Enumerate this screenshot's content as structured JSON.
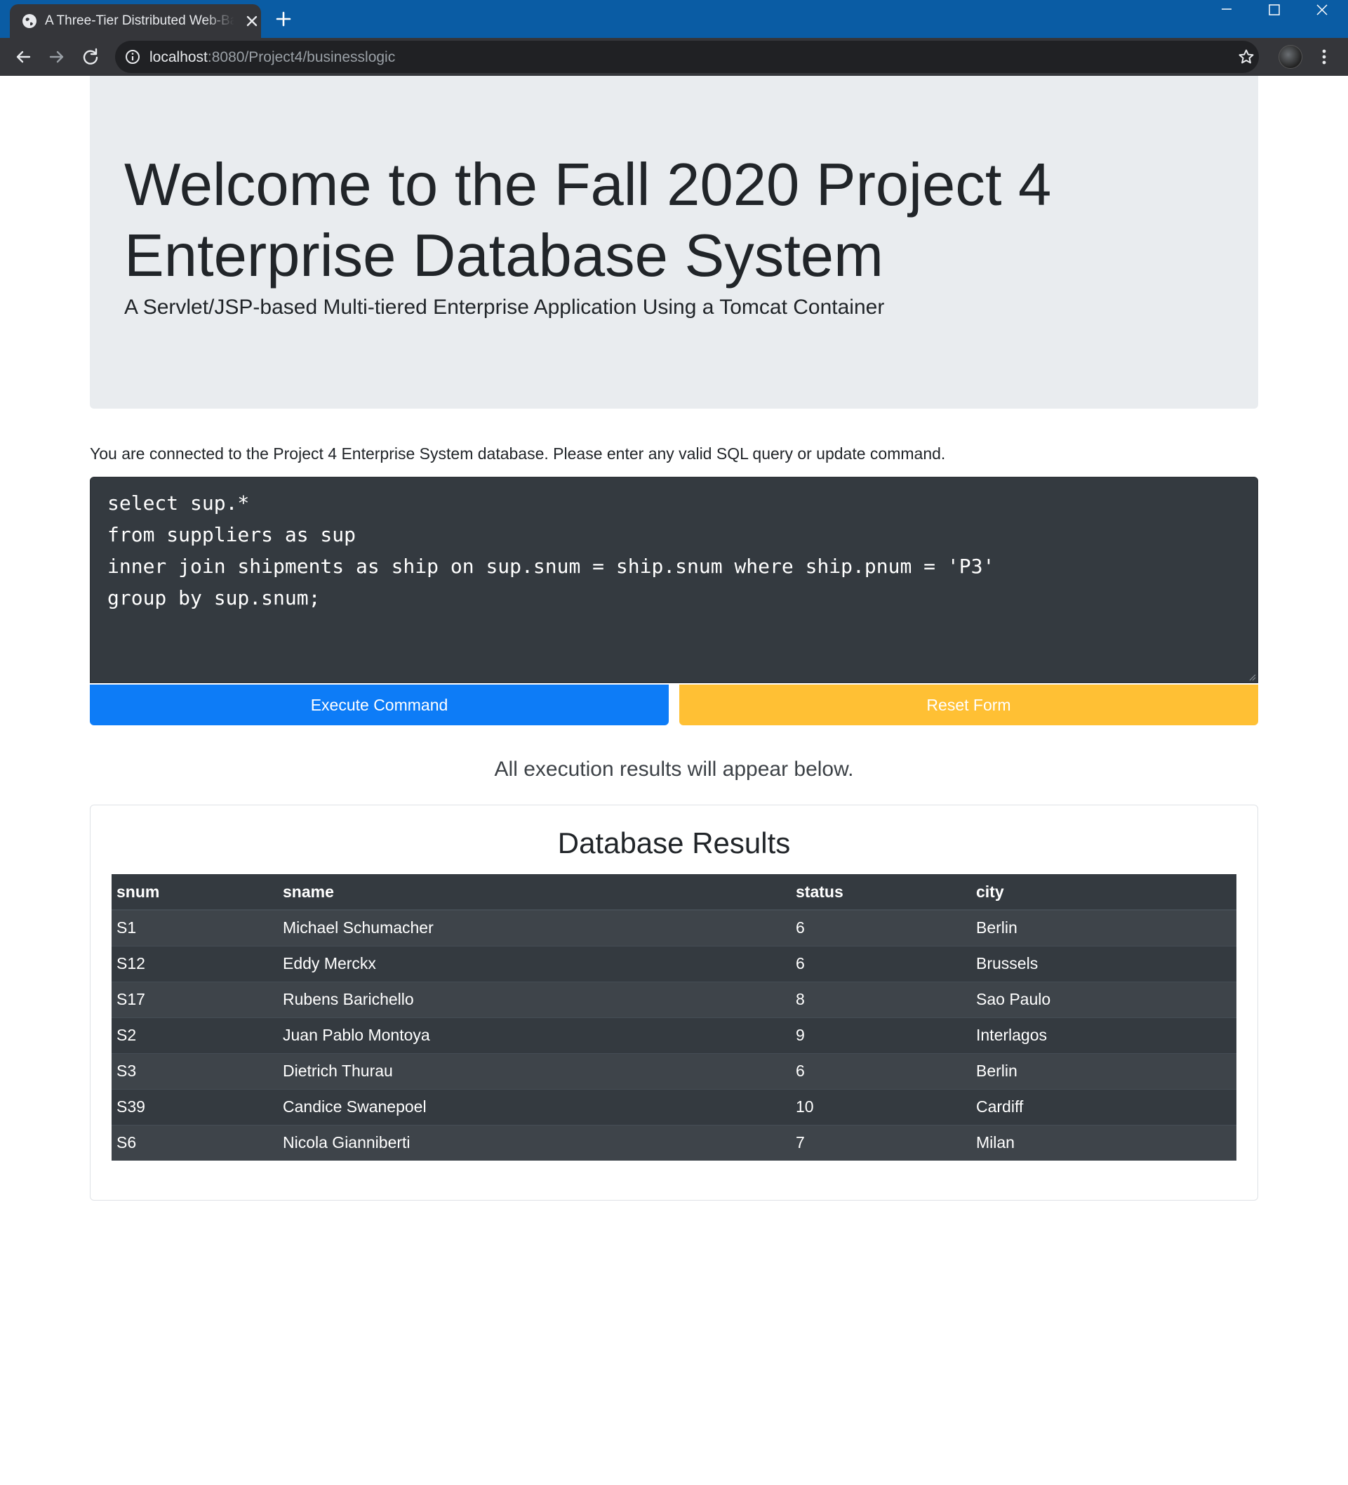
{
  "browser": {
    "tab_title": "A Three-Tier Distributed Web-Based Application",
    "url_host": "localhost",
    "url_rest": ":8080/Project4/businesslogic"
  },
  "jumbotron": {
    "title": "Welcome to the Fall 2020 Project 4 Enterprise Database System",
    "subtitle": "A Servlet/JSP-based Multi-tiered Enterprise Application Using a Tomcat Container"
  },
  "intro_text": "You are connected to the Project 4 Enterprise System database. Please enter any valid SQL query or update command.",
  "sql_query": {
    "lines": [
      "select sup.*",
      "from suppliers as sup",
      "inner join shipments as ship on sup.snum = ship.snum where ship.pnum = 'P3'",
      "group by sup.snum;"
    ]
  },
  "buttons": {
    "execute_label": "Execute Command",
    "reset_label": "Reset Form"
  },
  "results_note": "All execution results will appear below.",
  "results": {
    "title": "Database Results",
    "columns": [
      "snum",
      "sname",
      "status",
      "city"
    ],
    "rows": [
      [
        "S1",
        "Michael Schumacher",
        "6",
        "Berlin"
      ],
      [
        "S12",
        "Eddy Merckx",
        "6",
        "Brussels"
      ],
      [
        "S17",
        "Rubens Barichello",
        "8",
        "Sao Paulo"
      ],
      [
        "S2",
        "Juan Pablo Montoya",
        "9",
        "Interlagos"
      ],
      [
        "S3",
        "Dietrich Thurau",
        "6",
        "Berlin"
      ],
      [
        "S39",
        "Candice Swanepoel",
        "10",
        "Cardiff"
      ],
      [
        "S6",
        "Nicola Gianniberti",
        "7",
        "Milan"
      ]
    ]
  },
  "colors": {
    "titlebar": "#0a5ca4",
    "execute_button": "#0d7cf7",
    "reset_button": "#ffc034",
    "dark_panel": "#343a40",
    "jumbotron": "#e9ecef"
  },
  "icons": [
    "globe-icon",
    "close-icon",
    "plus-icon",
    "minimize-icon",
    "maximize-icon",
    "window-close-icon",
    "back-arrow-icon",
    "forward-arrow-icon",
    "reload-icon",
    "info-icon",
    "star-icon",
    "kebab-menu-icon"
  ]
}
